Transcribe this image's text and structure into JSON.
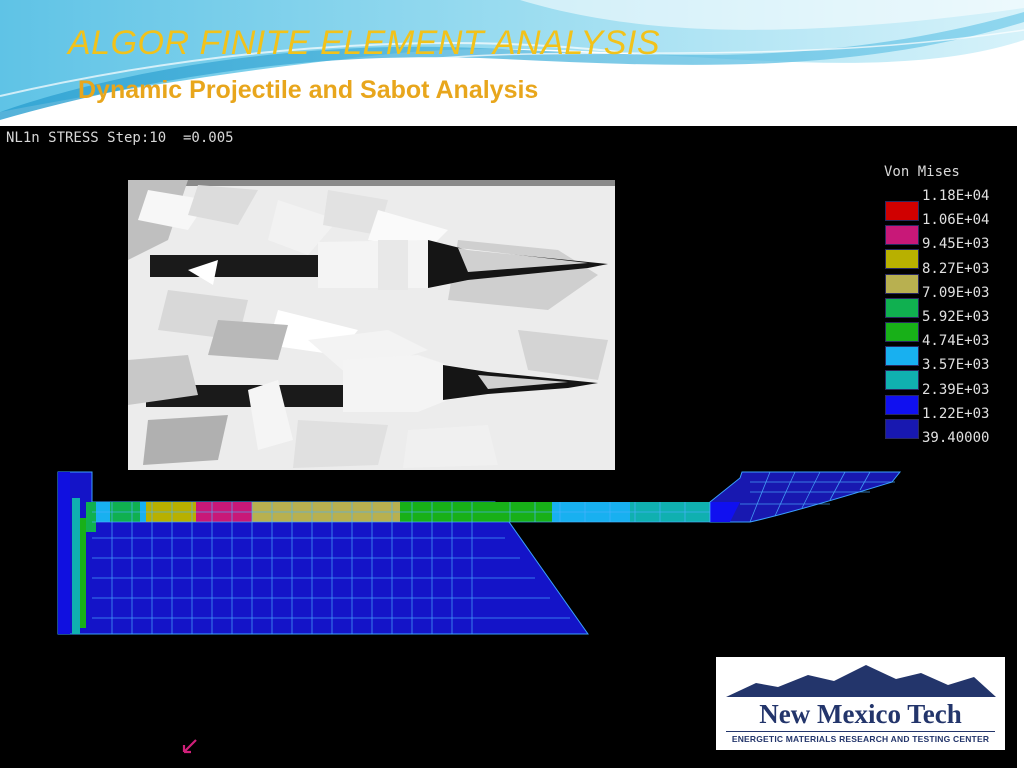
{
  "slide": {
    "title": "ALGOR FINITE ELEMENT ANALYSIS",
    "subtitle": "Dynamic Projectile and Sabot Analysis"
  },
  "simulation": {
    "status_line": "NL1n STRESS Step:10  =0.005",
    "legend": {
      "title": "Von Mises",
      "entries": [
        {
          "value": "1.18E+04",
          "color": "#d00000"
        },
        {
          "value": "1.06E+04",
          "color": "#c81878"
        },
        {
          "value": "9.45E+03",
          "color": "#b8b000"
        },
        {
          "value": "8.27E+03",
          "color": "#b8b050"
        },
        {
          "value": "7.09E+03",
          "color": "#10b050"
        },
        {
          "value": "5.92E+03",
          "color": "#18b018"
        },
        {
          "value": "4.74E+03",
          "color": "#18b0f0"
        },
        {
          "value": "3.57E+03",
          "color": "#10b0b0"
        },
        {
          "value": "2.39E+03",
          "color": "#1010f0"
        },
        {
          "value": "1.22E+03",
          "color": "#1818b0"
        },
        {
          "value": "39.40000",
          "color": null
        }
      ]
    },
    "photo_icon": "sabot-discard-photo",
    "cursor_icon": "pointer-arrow-icon"
  },
  "logo": {
    "name": "New Mexico Tech",
    "tagline": "ENERGETIC MATERIALS RESEARCH AND TESTING CENTER",
    "color": "#23356b"
  },
  "colors": {
    "title": "#f2c21a",
    "subtitle": "#e8a61c",
    "background": "#000000"
  }
}
